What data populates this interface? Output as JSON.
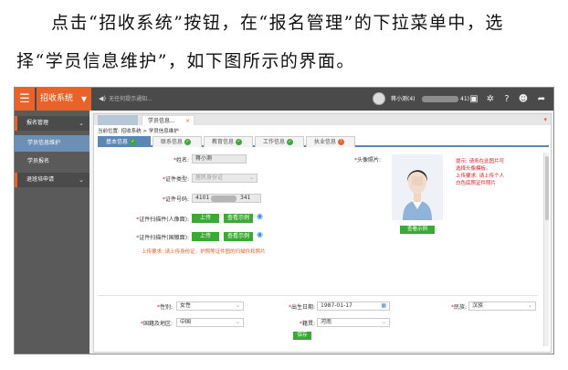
{
  "paragraph": {
    "line1": "点击“招收系统”按钮，在“报名管理”的下拉菜单中，选",
    "line2": "择“学员信息维护”，如下图所示的界面。"
  },
  "app": {
    "menu_icon": "hamburger-icon",
    "name": "招收系统",
    "notice": "无任何提示通知...",
    "user_prefix": "蒋小测(4)",
    "user_suffix": "41)",
    "toolbar_icons": [
      "document-icon",
      "gear-icon",
      "help-icon",
      "user-icon",
      "share-icon"
    ]
  },
  "sidebar": {
    "items": [
      {
        "label": "报名管理"
      },
      {
        "label": "学员信息维护"
      },
      {
        "label": "学员报名"
      },
      {
        "label": "退班培申请"
      }
    ]
  },
  "tabs": {
    "page_label": "学员信息...",
    "close": "×",
    "breadcrumb": "当前位置: 招收系统 > 学员信息维护"
  },
  "subtabs": [
    {
      "label": "基本信息"
    },
    {
      "label": "联系信息"
    },
    {
      "label": "教育信息"
    },
    {
      "label": "工作信息"
    },
    {
      "label": "执业信息"
    }
  ],
  "form": {
    "name_label": "姓名:",
    "name_value": "蒋小测",
    "id_type_label": "证件类型:",
    "id_type_value": "居民身份证",
    "id_number_label": "证件号码:",
    "id_number_prefix": "4101",
    "id_number_suffix": "341",
    "scan_front_label": "证件扫描件(人像面):",
    "scan_back_label": "证件扫描件(国徽面):",
    "upload_label": "上传",
    "example_label": "查看示例",
    "upload_hint": "上传要求: 请上传身份证、护照等证件图的扫描件和照片",
    "photo_label": "头像照片:",
    "photo_example": "查看示例",
    "photo_tip_1": "提示: 请务在此图片可",
    "photo_tip_2": "选择头像模板。",
    "photo_tip_3": "上传要求: 请上传个人",
    "photo_tip_4": "白色底照证件照片",
    "gender_label": "性别:",
    "gender_value": "女性",
    "birth_label": "出生日期:",
    "birth_value": "1987-01-17",
    "ethnic_label": "民族:",
    "ethnic_value": "汉族",
    "country_label": "国籍及地区:",
    "country_value": "中国",
    "native_label": "籍贯:",
    "native_value": "河南",
    "save_label": "保存"
  }
}
